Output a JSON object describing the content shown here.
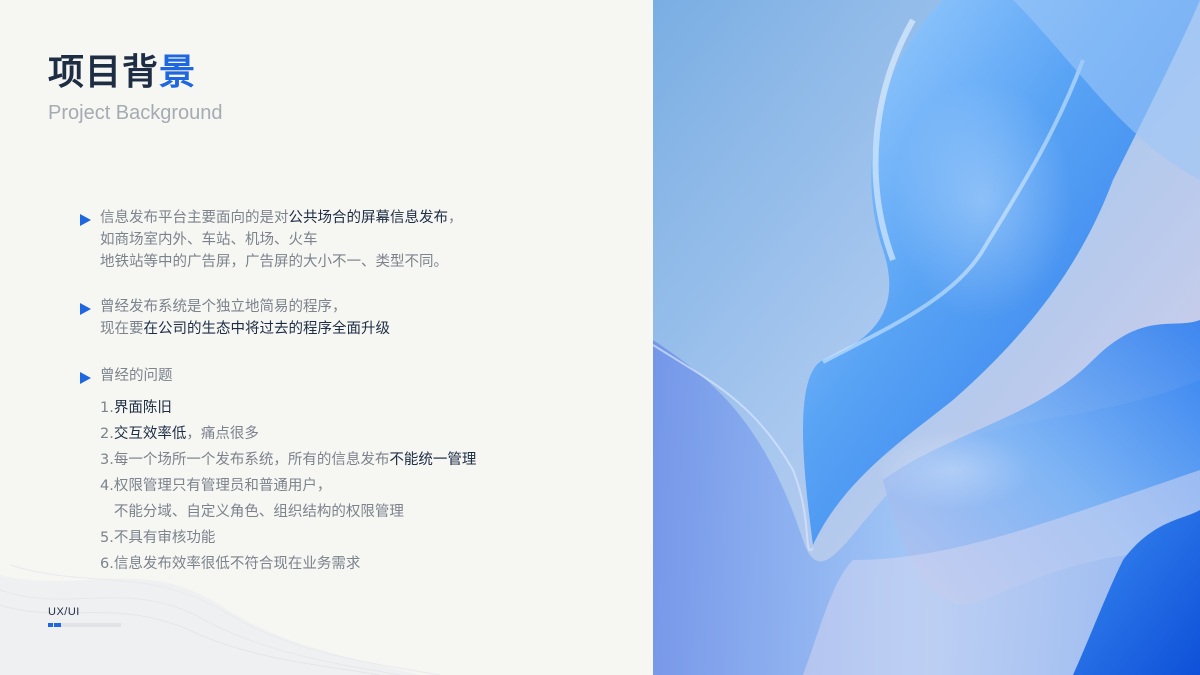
{
  "header": {
    "title_main": "项目背",
    "title_accent": "景",
    "subtitle": "Project Background"
  },
  "bullets": [
    {
      "line1_pre": "信息发布平台主要面向的是对",
      "line1_hl": "公共场合的屏幕信息发布",
      "line1_post": "，",
      "line2": "如商场室内外、车站、机场、火车",
      "line3": "地铁站等中的广告屏，广告屏的大小不一、类型不同。"
    },
    {
      "line1": "曾经发布系统是个独立地简易的程序，",
      "line2_pre": "现在要",
      "line2_hl": "在公司的生态中将过去的程序全面升级"
    },
    {
      "heading": "曾经的问题",
      "items": [
        {
          "pre": "1.",
          "hl": "界面陈旧",
          "post": ""
        },
        {
          "pre": "2.",
          "hl": "交互效率低",
          "post": "，痛点很多"
        },
        {
          "pre": "3.每一个场所一个发布系统，所有的信息发布",
          "hl": "不能统一管理",
          "post": ""
        },
        {
          "pre": "4.权限管理只有管理员和普通用户，",
          "hl": "",
          "post": ""
        },
        {
          "pre": "   不能分域、自定义角色、组织结构的权限管理",
          "hl": "",
          "post": ""
        },
        {
          "pre": "5.不具有审核功能",
          "hl": "",
          "post": ""
        },
        {
          "pre": "6.信息发布效率很低不符合现在业务需求",
          "hl": "",
          "post": ""
        }
      ]
    }
  ],
  "footer": {
    "label": "UX/UI"
  },
  "colors": {
    "accent": "#1f67e0",
    "heading": "#1d2d44",
    "body_text": "#7c838c",
    "subtitle": "#a5abb2"
  },
  "image": {
    "name": "blue-silk-abstract-image"
  }
}
